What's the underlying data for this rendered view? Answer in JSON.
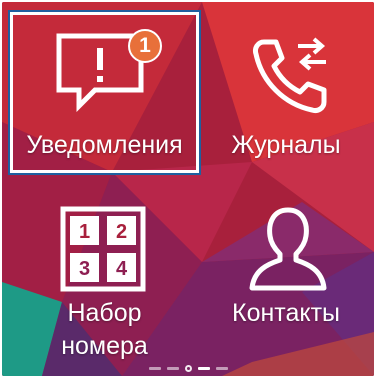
{
  "tiles": {
    "notifications": {
      "label": "Уведомления",
      "badge_count": "1",
      "icon": "notification-bubble-icon"
    },
    "logs": {
      "label": "Журналы",
      "icon": "phone-log-icon"
    },
    "dialpad": {
      "label_line1": "Набор",
      "label_line2": "номера",
      "icon": "keypad-icon",
      "keys": [
        "1",
        "2",
        "3",
        "4"
      ]
    },
    "contacts": {
      "label": "Контакты",
      "icon": "person-icon"
    }
  },
  "page_indicator": {
    "pages": 5,
    "current": 3
  },
  "colors": {
    "focus_frame": "#ffffff",
    "focus_outline": "#1f5fa0",
    "badge": "#e8703a",
    "background_primary": "#9a1f3e"
  }
}
